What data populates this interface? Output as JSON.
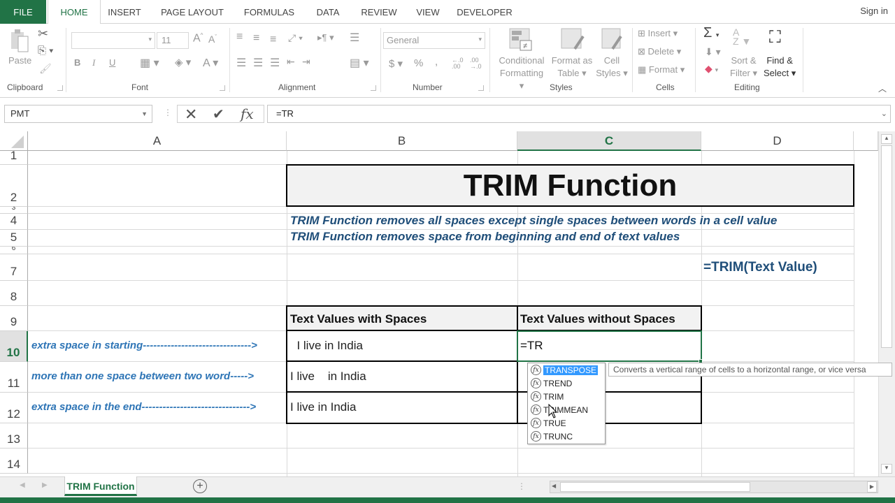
{
  "ribbon_tabs": [
    "FILE",
    "HOME",
    "INSERT",
    "PAGE LAYOUT",
    "FORMULAS",
    "DATA",
    "REVIEW",
    "VIEW",
    "DEVELOPER"
  ],
  "active_tab": "HOME",
  "sign_in": "Sign in",
  "ribbon": {
    "clipboard": {
      "label": "Clipboard",
      "paste": "Paste"
    },
    "font": {
      "label": "Font",
      "font_name": "",
      "font_size": "11",
      "bold": "B",
      "italic": "I",
      "underline": "U"
    },
    "alignment": {
      "label": "Alignment"
    },
    "number": {
      "label": "Number",
      "format": "General",
      "currency": "$",
      "percent": "%",
      "comma": ","
    },
    "styles": {
      "label": "Styles",
      "conditional": [
        "Conditional",
        "Formatting"
      ],
      "format_table": [
        "Format as",
        "Table"
      ],
      "cell_styles": [
        "Cell",
        "Styles"
      ]
    },
    "cells": {
      "label": "Cells",
      "insert": "Insert",
      "delete": "Delete",
      "format": "Format"
    },
    "editing": {
      "label": "Editing",
      "sort": [
        "Sort &",
        "Filter"
      ],
      "find": [
        "Find &",
        "Select"
      ]
    }
  },
  "formula_bar": {
    "name_box": "PMT",
    "formula": "=TR"
  },
  "columns": [
    "A",
    "B",
    "C",
    "D"
  ],
  "selected_column": "C",
  "rows": [
    "1",
    "2",
    "3",
    "4",
    "5",
    "6",
    "7",
    "8",
    "9",
    "10",
    "11",
    "12",
    "13",
    "14"
  ],
  "selected_row": "10",
  "sheet": {
    "title": "TRIM Function",
    "note1": "TRIM Function removes all spaces except single spaces between words in a cell value",
    "note2": "TRIM Function removes space from beginning and end of text values",
    "syntax": "=TRIM(Text Value)",
    "table_headers": [
      "Text Values with Spaces",
      "Text Values without Spaces"
    ],
    "table_rows": [
      {
        "label": "extra space in starting------------------------------->",
        "with_spaces": "  I live in India",
        "without_spaces": "=TR"
      },
      {
        "label": "more than one space between two word----->",
        "with_spaces": "I live    in India",
        "without_spaces": ""
      },
      {
        "label": "extra space in the end------------------------------->",
        "with_spaces": "I live in India",
        "without_spaces": ""
      }
    ]
  },
  "autocomplete": {
    "items": [
      "TRANSPOSE",
      "TREND",
      "TRIM",
      "TRIMMEAN",
      "TRUE",
      "TRUNC"
    ],
    "highlighted": "TRANSPOSE",
    "tooltip": "Converts a vertical range of cells to a horizontal range, or vice versa"
  },
  "sheet_tabs": [
    {
      "name": "TRIM Function",
      "active": true
    }
  ],
  "colors": {
    "excel_green": "#217346",
    "note_blue": "#1f4e79",
    "label_blue": "#2e75b6",
    "highlight": "#3399ff"
  }
}
